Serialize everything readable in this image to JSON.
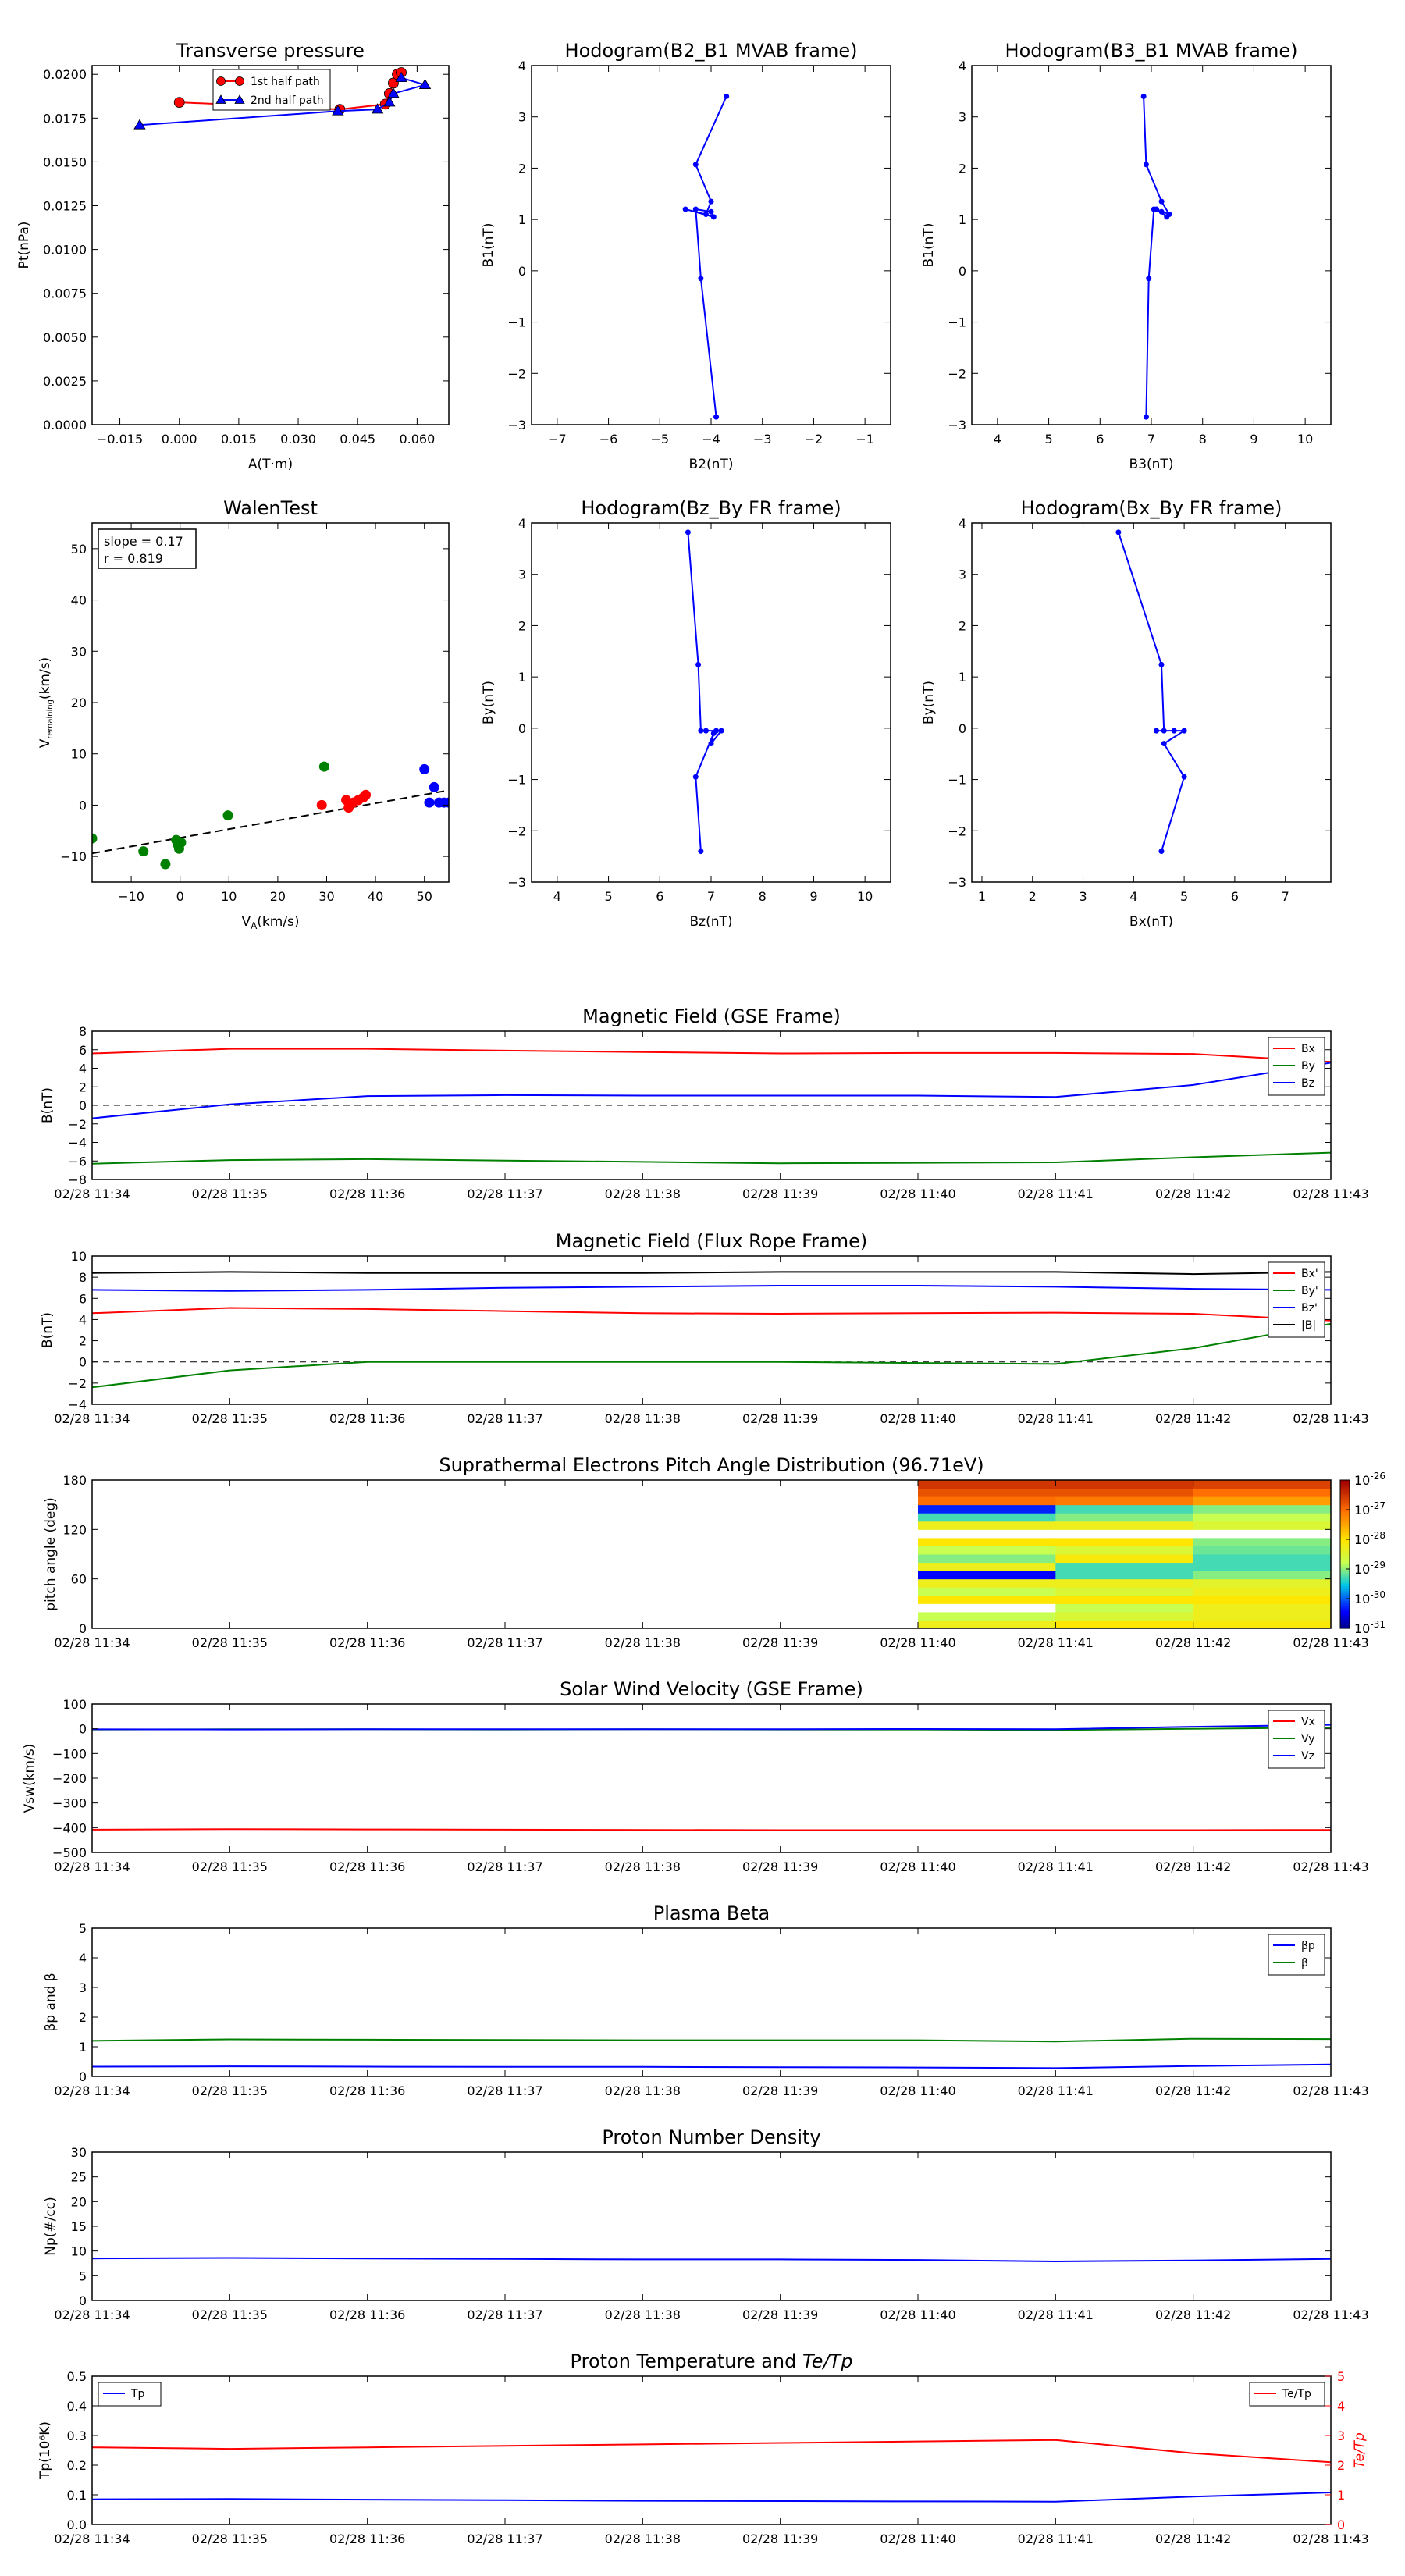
{
  "colors": {
    "red": "#ff0000",
    "green": "#008000",
    "blue": "#0000ff",
    "black": "#000000",
    "blue_marker": "#0000cc"
  },
  "time_ticks": [
    "02/28 11:34",
    "02/28 11:35",
    "02/28 11:36",
    "02/28 11:37",
    "02/28 11:38",
    "02/28 11:39",
    "02/28 11:40",
    "02/28 11:41",
    "02/28 11:42",
    "02/28 11:43"
  ],
  "chart_data": [
    {
      "id": "transverse",
      "type": "line",
      "title": "Transverse pressure",
      "xlabel": "A(T·m)",
      "ylabel": "Pt(nPa)",
      "xlim": [
        -0.022,
        0.068
      ],
      "ylim": [
        0,
        0.0205
      ],
      "xticks": [
        -0.015,
        0.0,
        0.015,
        0.03,
        0.045,
        0.06
      ],
      "xtick_labels": [
        "−0.015",
        "0.000",
        "0.015",
        "0.030",
        "0.045",
        "0.060"
      ],
      "yticks": [
        0,
        0.0025,
        0.005,
        0.0075,
        0.01,
        0.0125,
        0.015,
        0.0175,
        0.02
      ],
      "ytick_labels": [
        "0.0000",
        "0.0025",
        "0.0050",
        "0.0075",
        "0.0100",
        "0.0125",
        "0.0150",
        "0.0175",
        "0.0200"
      ],
      "legend": "top-center",
      "series": [
        {
          "name": "1st half path",
          "color": "red",
          "marker": "circle",
          "x": [
            0.0,
            0.0405,
            0.052,
            0.053,
            0.054,
            0.055,
            0.056
          ],
          "y": [
            0.0184,
            0.018,
            0.0183,
            0.0189,
            0.0195,
            0.02,
            0.0201
          ]
        },
        {
          "name": "2nd half path",
          "color": "blue",
          "marker": "triangle",
          "x": [
            0.056,
            0.062,
            0.054,
            0.053,
            0.05,
            0.04,
            -0.01
          ],
          "y": [
            0.0198,
            0.0194,
            0.0189,
            0.0184,
            0.018,
            0.0179,
            0.0171
          ]
        }
      ]
    },
    {
      "id": "hodo1",
      "type": "line",
      "title": "Hodogram(B2_B1 MVAB frame)",
      "xlabel": "B2(nT)",
      "ylabel": "B1(nT)",
      "xlim": [
        -7.5,
        -0.5
      ],
      "ylim": [
        -3,
        4
      ],
      "xticks": [
        -7,
        -6,
        -5,
        -4,
        -3,
        -2,
        -1
      ],
      "xtick_labels": [
        "−7",
        "−6",
        "−5",
        "−4",
        "−3",
        "−2",
        "−1"
      ],
      "yticks": [
        -3,
        -2,
        -1,
        0,
        1,
        2,
        3,
        4
      ],
      "ytick_labels": [
        "−3",
        "−2",
        "−1",
        "0",
        "1",
        "2",
        "3",
        "4"
      ],
      "series": [
        {
          "name": "",
          "color": "blue",
          "x": [
            -3.7,
            -4.3,
            -4.0,
            -4.1,
            -4.5,
            -3.95,
            -4.0,
            -4.3,
            -4.2,
            -3.9
          ],
          "y": [
            3.4,
            2.07,
            1.35,
            1.1,
            1.2,
            1.05,
            1.15,
            1.2,
            -0.15,
            -2.85
          ]
        }
      ]
    },
    {
      "id": "hodo2",
      "type": "line",
      "title": "Hodogram(B3_B1 MVAB frame)",
      "xlabel": "B3(nT)",
      "ylabel": "B1(nT)",
      "xlim": [
        3.5,
        10.5
      ],
      "ylim": [
        -3,
        4
      ],
      "xticks": [
        4,
        5,
        6,
        7,
        8,
        9,
        10
      ],
      "xtick_labels": [
        "4",
        "5",
        "6",
        "7",
        "8",
        "9",
        "10"
      ],
      "yticks": [
        -3,
        -2,
        -1,
        0,
        1,
        2,
        3,
        4
      ],
      "ytick_labels": [
        "−3",
        "−2",
        "−1",
        "0",
        "1",
        "2",
        "3",
        "4"
      ],
      "series": [
        {
          "name": "",
          "color": "blue",
          "x": [
            6.85,
            6.9,
            7.2,
            7.35,
            7.1,
            7.3,
            7.2,
            7.05,
            6.95,
            6.9
          ],
          "y": [
            3.4,
            2.07,
            1.35,
            1.1,
            1.2,
            1.05,
            1.15,
            1.2,
            -0.15,
            -2.85
          ]
        }
      ]
    },
    {
      "id": "walen",
      "type": "scatter",
      "title": "WalenTest",
      "xlabel": "V_A(km/s)",
      "ylabel": "V_remaining(km/s)",
      "xlim": [
        -18,
        55
      ],
      "ylim": [
        -15,
        55
      ],
      "xticks": [
        -10,
        0,
        10,
        20,
        30,
        40,
        50
      ],
      "xtick_labels": [
        "−10",
        "0",
        "10",
        "20",
        "30",
        "40",
        "50"
      ],
      "yticks": [
        -10,
        0,
        10,
        20,
        30,
        40,
        50
      ],
      "ytick_labels": [
        "−10",
        "0",
        "10",
        "20",
        "30",
        "40",
        "50"
      ],
      "annotation_lines": [
        "slope = 0.17",
        "r = 0.819"
      ],
      "fit_line": {
        "x": [
          -18,
          55
        ],
        "y": [
          -9.4,
          2.9
        ]
      },
      "series": [
        {
          "name": "",
          "color": "green",
          "x": [
            -18,
            -7.5,
            -3,
            -0.8,
            -0.4,
            -0.2,
            0.2,
            9.8,
            29.5
          ],
          "y": [
            -6.5,
            -9,
            -11.5,
            -6.8,
            -7.8,
            -8.5,
            -7.3,
            -2,
            7.5
          ]
        },
        {
          "name": "",
          "color": "red",
          "x": [
            29,
            34,
            34.5,
            35.5,
            36.5,
            37.5,
            38
          ],
          "y": [
            0,
            1,
            -0.5,
            0.5,
            1,
            1.5,
            2
          ]
        },
        {
          "name": "",
          "color": "blue",
          "x": [
            50,
            51,
            52,
            53,
            54,
            55
          ],
          "y": [
            7,
            0.5,
            3.5,
            0.5,
            0.5,
            0.5
          ]
        }
      ]
    },
    {
      "id": "hodo3",
      "type": "line",
      "title": "Hodogram(Bz_By FR frame)",
      "xlabel": "Bz(nT)",
      "ylabel": "By(nT)",
      "xlim": [
        3.5,
        10.5
      ],
      "ylim": [
        -3,
        4
      ],
      "xticks": [
        4,
        5,
        6,
        7,
        8,
        9,
        10
      ],
      "xtick_labels": [
        "4",
        "5",
        "6",
        "7",
        "8",
        "9",
        "10"
      ],
      "yticks": [
        -3,
        -2,
        -1,
        0,
        1,
        2,
        3,
        4
      ],
      "ytick_labels": [
        "−3",
        "−2",
        "−1",
        "0",
        "1",
        "2",
        "3",
        "4"
      ],
      "series": [
        {
          "name": "",
          "color": "blue",
          "x": [
            6.55,
            6.75,
            6.8,
            7.1,
            6.9,
            7.2,
            7.0,
            7.05,
            6.7,
            6.8
          ],
          "y": [
            3.82,
            1.24,
            -0.05,
            -0.05,
            -0.05,
            -0.05,
            -0.3,
            -0.1,
            -0.95,
            -2.4
          ]
        }
      ]
    },
    {
      "id": "hodo4",
      "type": "line",
      "title": "Hodogram(Bx_By FR frame)",
      "xlabel": "Bx(nT)",
      "ylabel": "By(nT)",
      "xlim": [
        0.8,
        7.9
      ],
      "ylim": [
        -3,
        4
      ],
      "xticks": [
        1,
        2,
        3,
        4,
        5,
        6,
        7
      ],
      "xtick_labels": [
        "1",
        "2",
        "3",
        "4",
        "5",
        "6",
        "7"
      ],
      "yticks": [
        -3,
        -2,
        -1,
        0,
        1,
        2,
        3,
        4
      ],
      "ytick_labels": [
        "−3",
        "−2",
        "−1",
        "0",
        "1",
        "2",
        "3",
        "4"
      ],
      "series": [
        {
          "name": "",
          "color": "blue",
          "x": [
            3.7,
            4.55,
            4.6,
            4.45,
            4.8,
            5.0,
            4.6,
            5.0,
            4.55
          ],
          "y": [
            3.82,
            1.24,
            -0.05,
            -0.05,
            -0.05,
            -0.05,
            -0.3,
            -0.95,
            -2.4
          ]
        }
      ]
    },
    {
      "id": "mag_gse",
      "type": "line",
      "title": "Magnetic Field (GSE Frame)",
      "ylabel": "B(nT)",
      "x": [
        0,
        1,
        2,
        3,
        4,
        5,
        6,
        7,
        8,
        9
      ],
      "ylim": [
        -8,
        8
      ],
      "yticks": [
        -8,
        -6,
        -4,
        -2,
        0,
        2,
        4,
        6,
        8
      ],
      "ytick_labels": [
        "−8",
        "−6",
        "−4",
        "−2",
        "0",
        "2",
        "4",
        "6",
        "8"
      ],
      "zero_line": true,
      "legend": "top-right",
      "series": [
        {
          "name": "Bx",
          "color": "red",
          "values": [
            5.6,
            6.1,
            6.1,
            5.9,
            5.75,
            5.6,
            5.65,
            5.65,
            5.55,
            4.7
          ]
        },
        {
          "name": "By",
          "color": "green",
          "values": [
            -6.3,
            -5.9,
            -5.8,
            -5.95,
            -6.1,
            -6.25,
            -6.2,
            -6.15,
            -5.6,
            -5.1
          ]
        },
        {
          "name": "Bz",
          "color": "blue",
          "values": [
            -1.4,
            0.1,
            1.0,
            1.1,
            1.05,
            1.05,
            1.05,
            0.9,
            2.2,
            4.6
          ]
        }
      ]
    },
    {
      "id": "mag_fr",
      "type": "line",
      "title": "Magnetic Field (Flux Rope Frame)",
      "ylabel": "B(nT)",
      "x": [
        0,
        1,
        2,
        3,
        4,
        5,
        6,
        7,
        8,
        9
      ],
      "ylim": [
        -4,
        10
      ],
      "yticks": [
        -4,
        -2,
        0,
        2,
        4,
        6,
        8,
        10
      ],
      "ytick_labels": [
        "−4",
        "−2",
        "0",
        "2",
        "4",
        "6",
        "8",
        "10"
      ],
      "zero_line": true,
      "legend": "top-right",
      "series": [
        {
          "name": "Bx'",
          "color": "red",
          "values": [
            4.6,
            5.1,
            5.0,
            4.8,
            4.6,
            4.55,
            4.6,
            4.65,
            4.55,
            3.9
          ]
        },
        {
          "name": "By'",
          "color": "green",
          "values": [
            -2.4,
            -0.8,
            0.0,
            0.0,
            0.0,
            0.0,
            -0.1,
            -0.2,
            1.3,
            3.6
          ]
        },
        {
          "name": "Bz'",
          "color": "blue",
          "values": [
            6.8,
            6.7,
            6.8,
            7.0,
            7.1,
            7.2,
            7.2,
            7.1,
            6.9,
            6.8
          ]
        },
        {
          "name": "|B|",
          "color": "black",
          "values": [
            8.4,
            8.5,
            8.4,
            8.4,
            8.4,
            8.5,
            8.5,
            8.5,
            8.3,
            8.5
          ]
        }
      ]
    },
    {
      "id": "pad",
      "type": "heatmap",
      "title": "Suprathermal Electrons Pitch Angle Distribution (96.71eV)",
      "ylabel": "pitch angle (deg)",
      "ylim": [
        0,
        180
      ],
      "yticks": [
        0,
        60,
        120,
        180
      ],
      "ytick_labels": [
        "0",
        "60",
        "120",
        "180"
      ],
      "colorbar_ticks": [
        "10⁻²⁶",
        "10⁻²⁷",
        "10⁻²⁸",
        "10⁻²⁹",
        "10⁻³⁰",
        "10⁻³¹"
      ],
      "colorbar_label_exponents": [
        "-26",
        "-27",
        "-28",
        "-29",
        "-30",
        "-31"
      ],
      "colorbar_base": "10",
      "x_start": 6,
      "x_end": 9,
      "bins": 18,
      "columns": [
        [
          0.55,
          0.45,
          0.05,
          0.6,
          0.45,
          0.55,
          0.12,
          0.55,
          0.4,
          0.45,
          0.6,
          0.05,
          0.55,
          0.35,
          0.15,
          0.8,
          0.85,
          0.9
        ],
        [
          0.6,
          0.5,
          0.45,
          0.6,
          0.5,
          0.55,
          0.35,
          0.35,
          0.58,
          0.5,
          0.6,
          0.05,
          0.55,
          0.4,
          0.35,
          0.78,
          0.85,
          0.9
        ],
        [
          0.58,
          0.55,
          0.55,
          0.6,
          0.55,
          0.52,
          0.4,
          0.35,
          0.35,
          0.38,
          0.4,
          0.05,
          0.5,
          0.45,
          0.4,
          0.72,
          0.8,
          0.88
        ]
      ]
    },
    {
      "id": "vsw",
      "type": "line",
      "title": "Solar Wind Velocity (GSE Frame)",
      "ylabel": "Vsw(km/s)",
      "x": [
        0,
        1,
        2,
        3,
        4,
        5,
        6,
        7,
        8,
        9
      ],
      "ylim": [
        -500,
        100
      ],
      "yticks": [
        -500,
        -400,
        -300,
        -200,
        -100,
        0,
        100
      ],
      "ytick_labels": [
        "−500",
        "−400",
        "−300",
        "−200",
        "−100",
        "0",
        "100"
      ],
      "legend": "top-right",
      "series": [
        {
          "name": "Vx",
          "color": "red",
          "values": [
            -408,
            -406,
            -407,
            -408,
            -409,
            -410,
            -410,
            -410,
            -410,
            -409
          ]
        },
        {
          "name": "Vy",
          "color": "green",
          "values": [
            -3,
            -2,
            -2,
            -3,
            -2,
            -3,
            -3,
            -5,
            0,
            5
          ]
        },
        {
          "name": "Vz",
          "color": "blue",
          "values": [
            -2,
            -3,
            -2,
            -2,
            -2,
            -2,
            -1,
            -2,
            8,
            16
          ]
        }
      ]
    },
    {
      "id": "beta",
      "type": "line",
      "title": "Plasma Beta",
      "ylabel": "βp and β",
      "x": [
        0,
        1,
        2,
        3,
        4,
        5,
        6,
        7,
        8,
        9
      ],
      "ylim": [
        0,
        5
      ],
      "yticks": [
        0,
        1,
        2,
        3,
        4,
        5
      ],
      "ytick_labels": [
        "0",
        "1",
        "2",
        "3",
        "4",
        "5"
      ],
      "legend": "top-right",
      "series": [
        {
          "name": "βp",
          "color": "blue",
          "values": [
            0.33,
            0.34,
            0.33,
            0.32,
            0.32,
            0.31,
            0.3,
            0.28,
            0.35,
            0.4
          ]
        },
        {
          "name": "β",
          "color": "green",
          "values": [
            1.2,
            1.25,
            1.24,
            1.23,
            1.22,
            1.22,
            1.22,
            1.18,
            1.27,
            1.26
          ]
        }
      ]
    },
    {
      "id": "np",
      "type": "line",
      "title": "Proton Number Density",
      "ylabel": "Np(#/cc)",
      "x": [
        0,
        1,
        2,
        3,
        4,
        5,
        6,
        7,
        8,
        9
      ],
      "ylim": [
        0,
        30
      ],
      "yticks": [
        0,
        5,
        10,
        15,
        20,
        25,
        30
      ],
      "ytick_labels": [
        "0",
        "5",
        "10",
        "15",
        "20",
        "25",
        "30"
      ],
      "series": [
        {
          "name": "",
          "color": "blue",
          "values": [
            8.5,
            8.6,
            8.5,
            8.4,
            8.3,
            8.3,
            8.2,
            7.9,
            8.1,
            8.4
          ]
        }
      ]
    },
    {
      "id": "tp",
      "type": "line",
      "title": "Proton Temperature and Te/Tp",
      "title_main": "Proton Temperature and ",
      "title_math": "Te/Tp",
      "ylabel": "Tp(10⁶K)",
      "ylabel_right": "Te/Tp",
      "x": [
        0,
        1,
        2,
        3,
        4,
        5,
        6,
        7,
        8,
        9
      ],
      "ylim": [
        0,
        0.5
      ],
      "yticks": [
        0,
        0.1,
        0.2,
        0.3,
        0.4,
        0.5
      ],
      "ytick_labels": [
        "0.0",
        "0.1",
        "0.2",
        "0.3",
        "0.4",
        "0.5"
      ],
      "ylim_right": [
        0,
        5
      ],
      "yticks_right": [
        0,
        1,
        2,
        3,
        4,
        5
      ],
      "ytick_labels_right": [
        "0",
        "1",
        "2",
        "3",
        "4",
        "5"
      ],
      "series": [
        {
          "name": "Tp",
          "color": "blue",
          "axis": "left",
          "values": [
            0.085,
            0.086,
            0.084,
            0.082,
            0.08,
            0.079,
            0.078,
            0.077,
            0.094,
            0.108
          ]
        },
        {
          "name": "Te/Tp",
          "color": "red",
          "axis": "right",
          "values": [
            2.6,
            2.55,
            2.6,
            2.65,
            2.7,
            2.75,
            2.8,
            2.85,
            2.4,
            2.1
          ]
        }
      ]
    }
  ]
}
